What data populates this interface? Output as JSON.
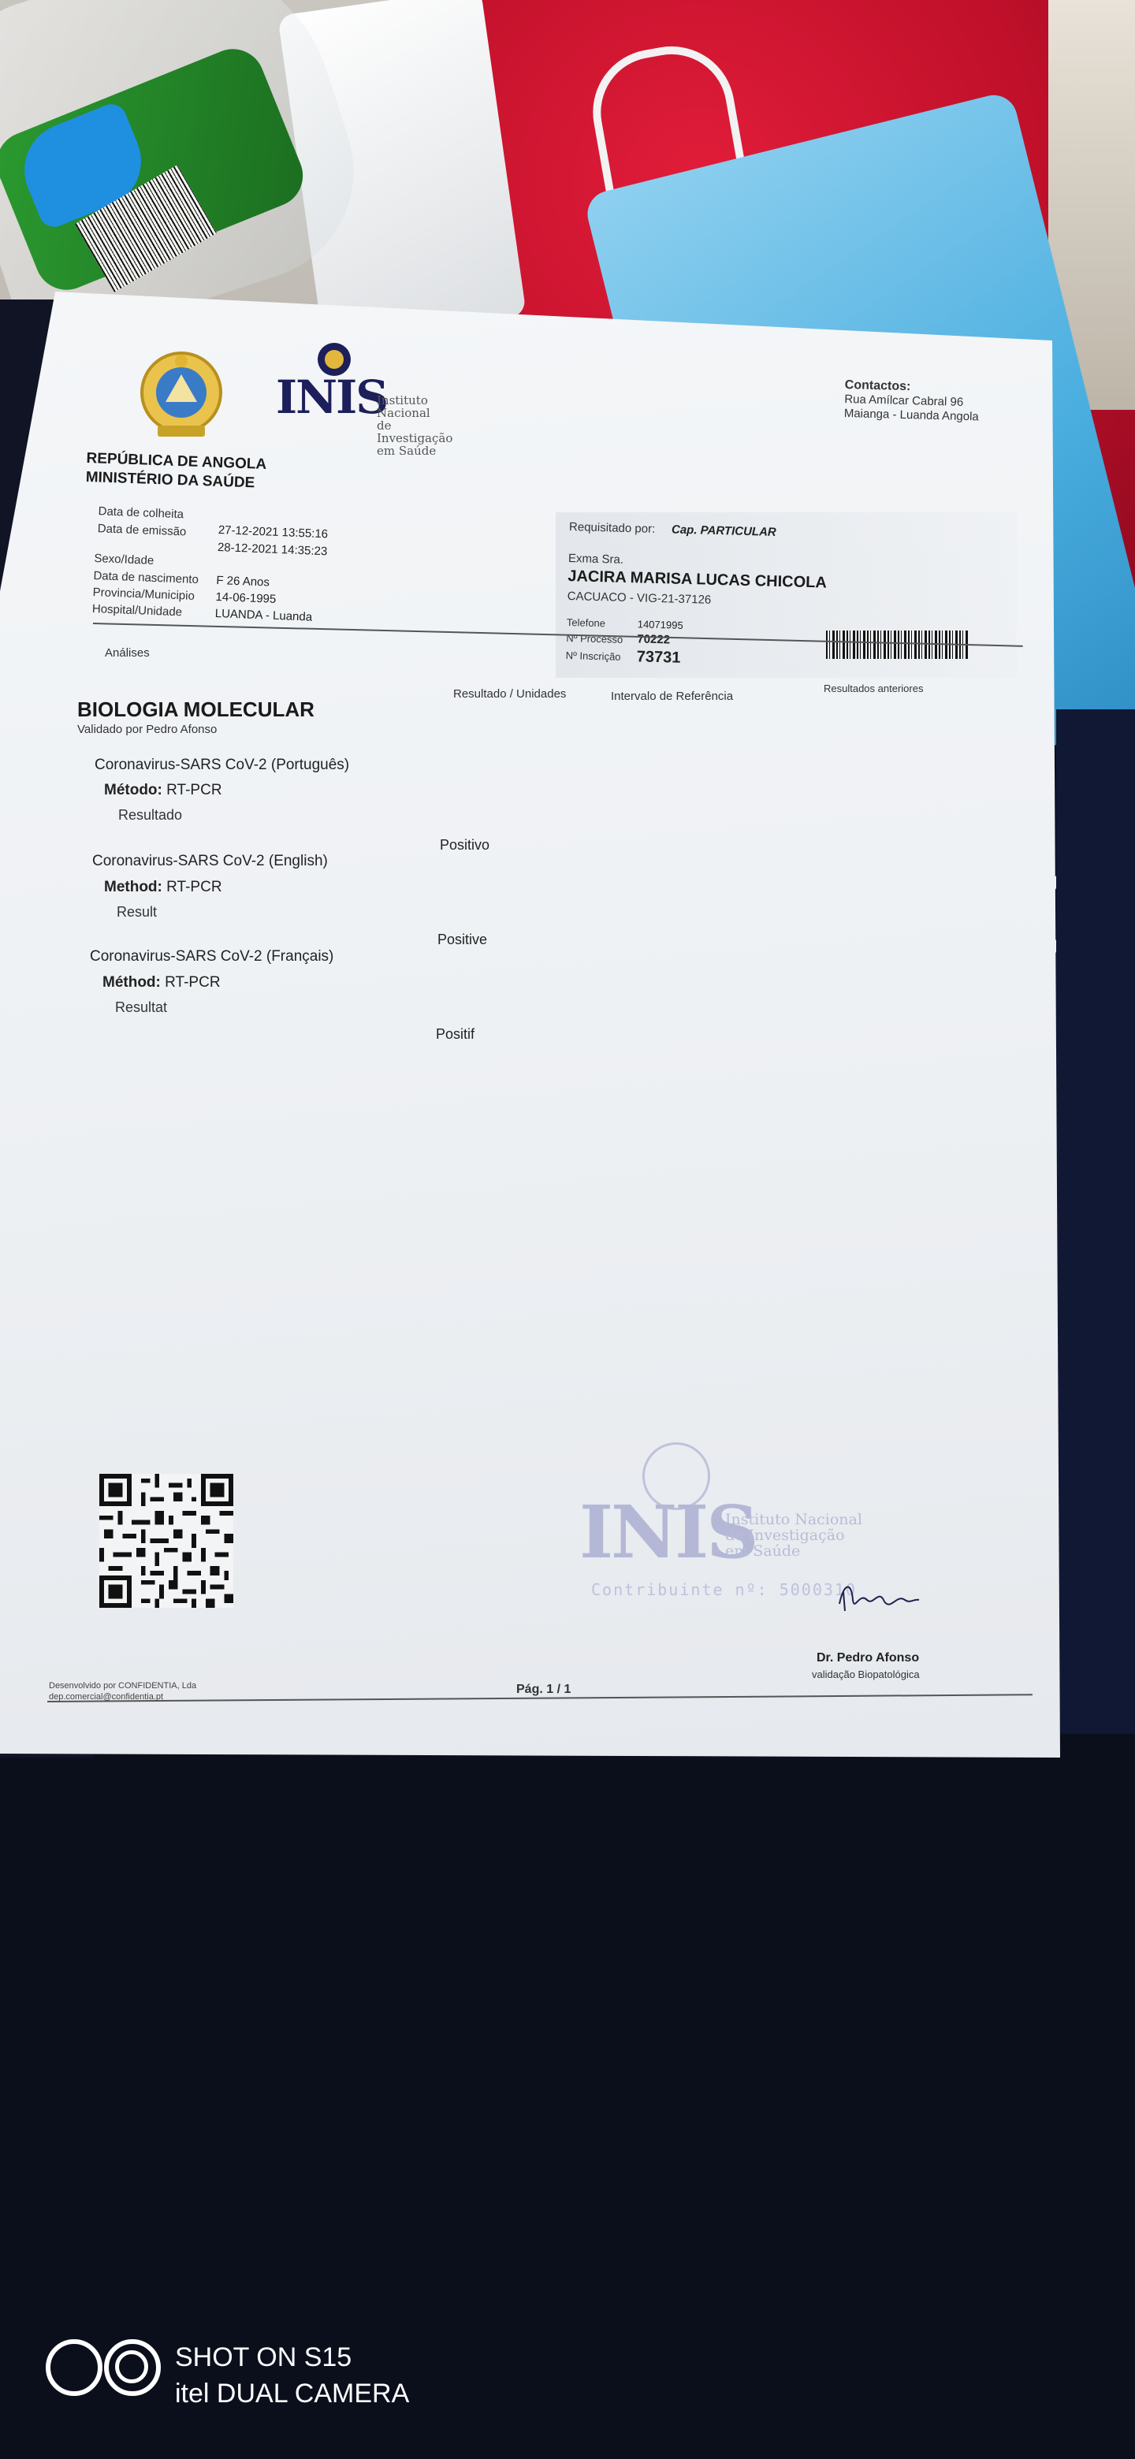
{
  "document": {
    "header": {
      "republic": "REPÚBLICA DE ANGOLA",
      "ministry": "MINISTÉRIO DA SAÚDE",
      "institute_mark": "INIS",
      "institute_tagline_1": "Instituto Nacional",
      "institute_tagline_2": "de Investigação",
      "institute_tagline_3": "em Saúde",
      "contact_title": "Contactos:",
      "contact_line_1": "Rua Amílcar Cabral 96",
      "contact_line_2": "Maianga - Luanda Angola"
    },
    "collection": {
      "collected_label": "Data de colheita",
      "collected_value": "27-12-2021 13:55:16",
      "issued_label": "Data de emissão",
      "issued_value": "28-12-2021 14:35:23"
    },
    "patient_info": {
      "sex_age_label": "Sexo/Idade",
      "sex_age_value": "F 26 Anos",
      "birth_label": "Data de nascimento",
      "birth_value": "14-06-1995",
      "province_label": "Provincia/Municipio",
      "province_value": "LUANDA - Luanda",
      "hospital_label": "Hospital/Unidade"
    },
    "request": {
      "requested_by_label": "Requisitado por:",
      "requested_by_value": "Cap. PARTICULAR",
      "salutation": "Exma Sra.",
      "patient_name": "JACIRA MARISA LUCAS CHICOLA",
      "patient_ref": "CACUACO - VIG-21-37126",
      "phone_label": "Telefone",
      "phone_value": "14071995",
      "process_label": "Nº Processo",
      "process_value": "70222",
      "inscription_label": "Nº Inscrição",
      "inscription_value": "73731"
    },
    "columns": {
      "analyses": "Análises",
      "result_units": "Resultado / Unidades",
      "reference_interval": "Intervalo de Referência",
      "previous_results": "Resultados anteriores"
    },
    "section": {
      "title": "BIOLOGIA MOLECULAR",
      "validated_by": "Validado por Pedro Afonso"
    },
    "tests": [
      {
        "name": "Coronavirus-SARS CoV-2 (Português)",
        "method_label": "Método:",
        "method_value": "RT-PCR",
        "result_label": "Resultado",
        "result_value": "Positivo"
      },
      {
        "name": "Coronavirus-SARS CoV-2 (English)",
        "method_label": "Method:",
        "method_value": "RT-PCR",
        "result_label": "Result",
        "result_value": "Positive"
      },
      {
        "name": "Coronavirus-SARS CoV-2 (Français)",
        "method_label": "Méthod:",
        "method_value": "RT-PCR",
        "result_label": "Resultat",
        "result_value": "Positif"
      }
    ],
    "stamp": {
      "mark": "INIS",
      "tag_1": "Instituto Nacional",
      "tag_2": "de Investigação",
      "tag_3": "em Saúde",
      "contribuinte": "Contribuinte nº: 5000310"
    },
    "signature": {
      "name": "Dr. Pedro Afonso",
      "role": "validação Biopatológica"
    },
    "footer": {
      "developer_line_1": "Desenvolvido por CONFIDENTIA, Lda",
      "developer_line_2": "dep.comercial@confidentia.pt",
      "page": "Pág. 1 / 1"
    }
  },
  "camera_watermark": {
    "line_1": "SHOT ON S15",
    "line_2": "itel DUAL CAMERA"
  }
}
